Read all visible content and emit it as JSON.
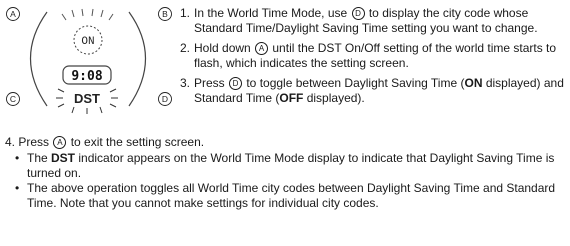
{
  "figure": {
    "button_labels": [
      "A",
      "B",
      "C",
      "D"
    ],
    "on_indicator": "ON",
    "time_display": "9:08",
    "dst_indicator": "DST"
  },
  "steps": [
    {
      "num": "1.",
      "parts": [
        {
          "t": "In the World Time Mode, use "
        },
        {
          "btn": "D"
        },
        {
          "t": " to display the city code whose Standard Time/Daylight Saving Time setting you want to change."
        }
      ]
    },
    {
      "num": "2.",
      "parts": [
        {
          "t": "Hold down "
        },
        {
          "btn": "A"
        },
        {
          "t": " until the DST On/Off setting of the world time starts to flash, which indicates the setting screen."
        }
      ]
    },
    {
      "num": "3.",
      "parts": [
        {
          "t": "Press "
        },
        {
          "btn": "D"
        },
        {
          "t": " to toggle between Daylight Saving Time ("
        },
        {
          "b": "ON"
        },
        {
          "t": " displayed) and Standard Time ("
        },
        {
          "b": "OFF"
        },
        {
          "t": " displayed)."
        }
      ]
    }
  ],
  "step4": {
    "num": "4.",
    "parts": [
      {
        "t": "Press "
      },
      {
        "btn": "A"
      },
      {
        "t": " to exit the setting screen."
      }
    ],
    "bullets": [
      [
        {
          "t": "The "
        },
        {
          "b": "DST"
        },
        {
          "t": " indicator appears on the World Time Mode display to indicate that Daylight Saving Time is turned on."
        }
      ],
      [
        {
          "t": "The above operation toggles all World Time city codes between Daylight Saving Time and Standard Time. Note that you cannot make settings for individual city codes."
        }
      ]
    ]
  }
}
